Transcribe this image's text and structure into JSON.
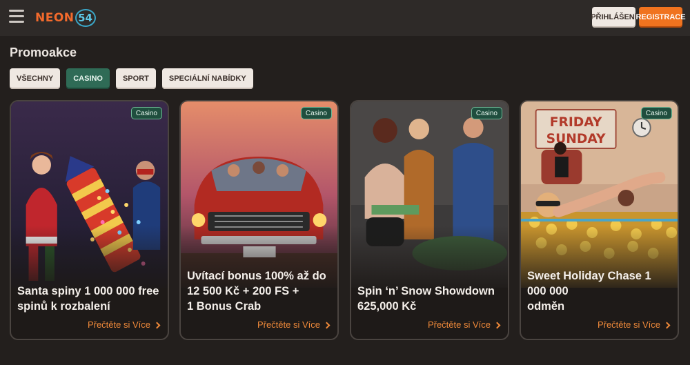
{
  "header": {
    "logo_text": "NEON",
    "logo_num": "54",
    "login_label": "PŘIHLÁŠENÍ",
    "register_label": "REGISTRACE"
  },
  "page": {
    "title": "Promoakce"
  },
  "filters": [
    {
      "label": "VŠECHNY",
      "active": false
    },
    {
      "label": "CASINO",
      "active": true
    },
    {
      "label": "SPORT",
      "active": false
    },
    {
      "label": "SPECIÁLNÍ NABÍDKY",
      "active": false
    }
  ],
  "cards": [
    {
      "badge": "Casino",
      "title": "Santa spiny 1 000 000 free\nspinů k rozbalení",
      "link": "Přečtěte si Více",
      "image": "santa-promo"
    },
    {
      "badge": "Casino",
      "title": "Uvítací bonus 100% až do\n12 500 Kč + 200 FS +\n1 Bonus Crab",
      "link": "Přečtěte si Více",
      "image": "car-promo"
    },
    {
      "badge": "Casino",
      "title": "Spin ‘n’ Snow Showdown\n625,000 Kč",
      "link": "Přečtěte si Více",
      "image": "party-promo"
    },
    {
      "badge": "Casino",
      "title": "Sweet Holiday Chase 1 000 000\nodměn",
      "link": "Přečtěte si Více",
      "image": "pool-promo",
      "sign_line1": "FRIDAY",
      "sign_line2": "SUNDAY"
    }
  ],
  "colors": {
    "accent": "#f0731f",
    "active_chip": "#2f6b56",
    "link": "#f08a3a",
    "background": "#231f1d"
  }
}
